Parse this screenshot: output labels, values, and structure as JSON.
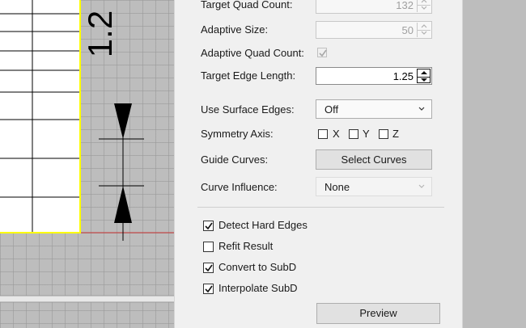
{
  "viewport": {
    "dimension_text": "1.2",
    "colors": {
      "background": "#bdbdbd",
      "grid": "#9a9a9a",
      "selection": "#ffff00",
      "axis": "#c83232",
      "geometry": "#000000"
    }
  },
  "panel": {
    "target_quad_count": {
      "label": "Target Quad Count:",
      "value": "132"
    },
    "adaptive_size": {
      "label": "Adaptive Size:",
      "value": "50"
    },
    "adaptive_quad_count": {
      "label": "Adaptive Quad Count:",
      "checked": true
    },
    "target_edge_length": {
      "label": "Target Edge Length:",
      "value": "1.25"
    },
    "use_surface_edges": {
      "label": "Use Surface Edges:",
      "value": "Off"
    },
    "symmetry_axis": {
      "label": "Symmetry Axis:",
      "x": "X",
      "y": "Y",
      "z": "Z"
    },
    "guide_curves": {
      "label": "Guide Curves:",
      "button": "Select Curves"
    },
    "curve_influence": {
      "label": "Curve Influence:",
      "value": "None"
    },
    "options": {
      "detect_hard_edges": {
        "label": "Detect Hard Edges",
        "checked": true
      },
      "refit_result": {
        "label": "Refit Result",
        "checked": false
      },
      "convert_to_subd": {
        "label": "Convert to SubD",
        "checked": true
      },
      "interpolate_subd": {
        "label": "Interpolate SubD",
        "checked": true
      }
    },
    "preview_button": "Preview"
  }
}
